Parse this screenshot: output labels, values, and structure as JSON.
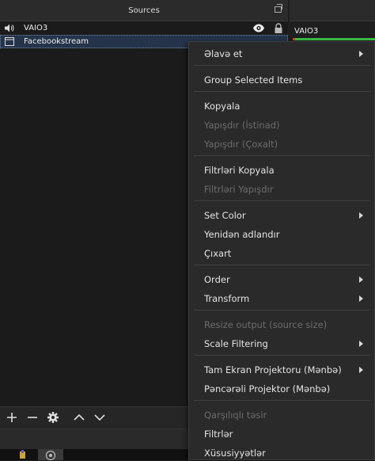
{
  "sources_panel": {
    "title": "Sources",
    "items": [
      {
        "name": "VAIO3",
        "icon": "speaker-icon",
        "visible_icon": "eye-icon",
        "lock_icon": "lock-icon"
      },
      {
        "name": "Facebookstream",
        "icon": "window-capture-icon",
        "selected": true
      }
    ]
  },
  "toolbar": {
    "icons": [
      "plus-icon",
      "minus-icon",
      "gear-icon",
      "chevron-up-icon",
      "chevron-down-icon"
    ]
  },
  "mixer": {
    "channel_label": "VAIO3",
    "meter_colors": {
      "level": "#3dbf4b",
      "peak": "#e23b2e"
    }
  },
  "context_menu": {
    "items": [
      {
        "label": "Əlavə et",
        "enabled": true,
        "submenu": true
      },
      {
        "label": "Group Selected Items",
        "enabled": true
      },
      {
        "label": "Kopyala",
        "enabled": true
      },
      {
        "label": "Yapışdır (İstinad)",
        "enabled": false
      },
      {
        "label": "Yapışdır (Çoxalt)",
        "enabled": false
      },
      {
        "label": "Filtrləri Kopyala",
        "enabled": true
      },
      {
        "label": "Filtrləri Yapışdır",
        "enabled": false
      },
      {
        "label": "Set Color",
        "enabled": true,
        "submenu": true
      },
      {
        "label": "Yenidən adlandır",
        "enabled": true
      },
      {
        "label": "Çıxart",
        "enabled": true
      },
      {
        "label": "Order",
        "enabled": true,
        "submenu": true
      },
      {
        "label": "Transform",
        "enabled": true,
        "submenu": true
      },
      {
        "label": "Resize output (source size)",
        "enabled": false
      },
      {
        "label": "Scale Filtering",
        "enabled": true,
        "submenu": true
      },
      {
        "label": "Tam Ekran Projektoru (Mənbə)",
        "enabled": true,
        "submenu": true
      },
      {
        "label": "Pəncərəli Projektor (Mənbə)",
        "enabled": true
      },
      {
        "label": "Qarşılıqlı təsir",
        "enabled": false
      },
      {
        "label": "Filtrlər",
        "enabled": true
      },
      {
        "label": "Xüsusiyyətlər",
        "enabled": true
      }
    ]
  }
}
